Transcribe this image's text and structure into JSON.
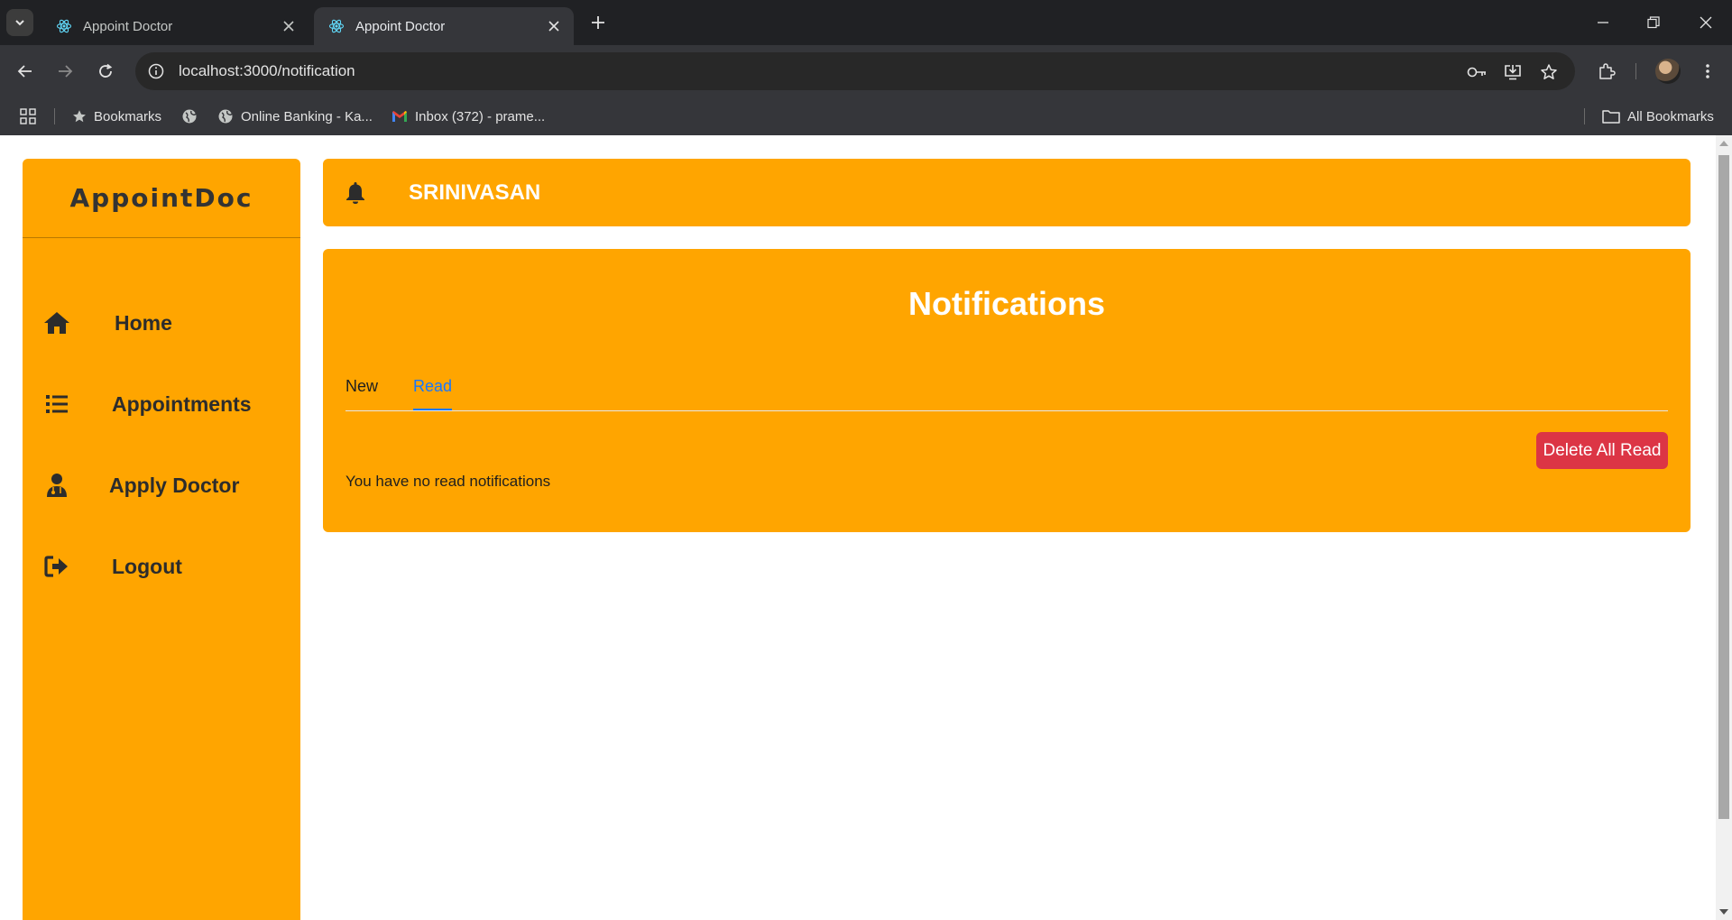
{
  "browser": {
    "tabs": [
      {
        "title": "Appoint Doctor",
        "active": false
      },
      {
        "title": "Appoint Doctor",
        "active": true
      }
    ],
    "url": "localhost:3000/notification",
    "bookmarks": [
      {
        "label": "Bookmarks",
        "icon": "star-icon"
      },
      {
        "label": "",
        "icon": "globe-icon"
      },
      {
        "label": "Online Banking - Ka...",
        "icon": "globe-icon"
      },
      {
        "label": "Inbox (372) - prame...",
        "icon": "gmail-icon"
      }
    ],
    "all_bookmarks": "All Bookmarks"
  },
  "sidebar": {
    "brand": "AppointDoc",
    "items": [
      {
        "label": "Home",
        "icon": "home-icon"
      },
      {
        "label": "Appointments",
        "icon": "list-icon"
      },
      {
        "label": "Apply Doctor",
        "icon": "user-doctor-icon"
      },
      {
        "label": "Logout",
        "icon": "logout-icon"
      }
    ]
  },
  "header": {
    "username": "SRINIVASAN",
    "icon": "bell-icon"
  },
  "notifications": {
    "title": "Notifications",
    "tabs": [
      {
        "label": "New",
        "active": false
      },
      {
        "label": "Read",
        "active": true
      }
    ],
    "delete_all_label": "Delete All Read",
    "empty_message": "You have no read notifications"
  },
  "colors": {
    "accent": "#ffa500",
    "danger": "#dc3545",
    "active_tab": "#1677ff"
  }
}
